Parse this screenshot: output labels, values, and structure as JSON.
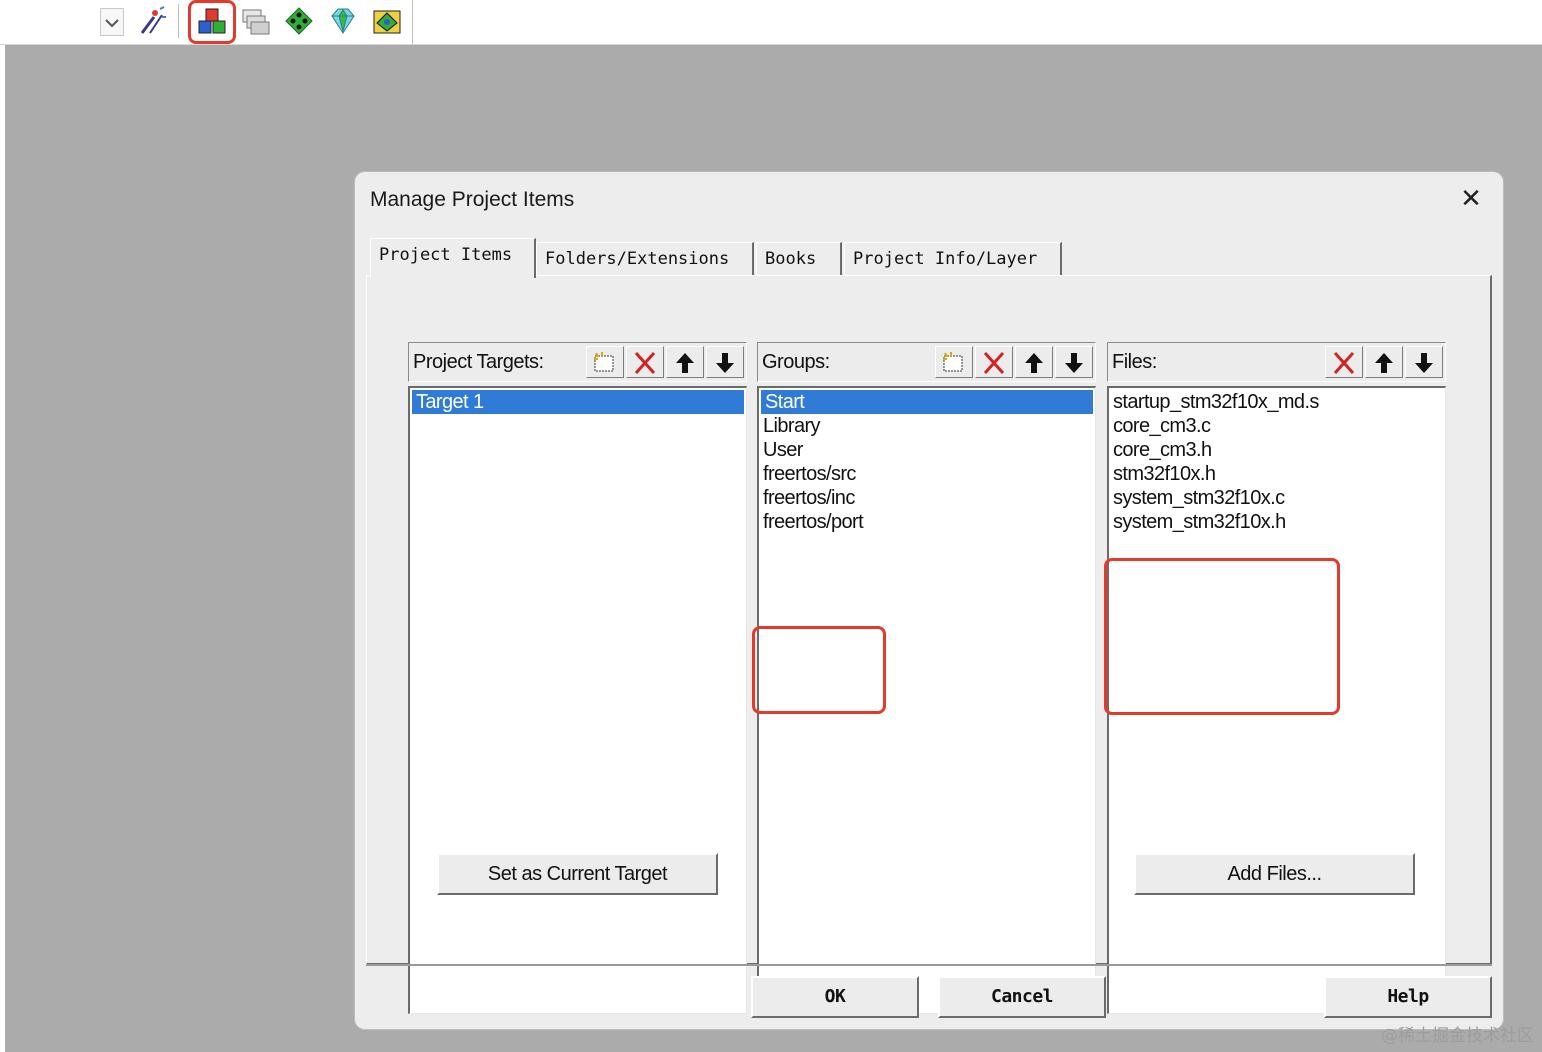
{
  "toolbar": {
    "icons": [
      "dropdown-arrow-icon",
      "magic-wand-icon",
      "manage-project-items-icon",
      "select-packs-icon",
      "manage-run-time-environment-icon",
      "pack-installer-icon",
      "components-icon"
    ]
  },
  "dialog": {
    "title": "Manage Project Items",
    "close_symbol": "✕",
    "tabs": [
      {
        "label": "Project Items"
      },
      {
        "label": "Folders/Extensions"
      },
      {
        "label": "Books"
      },
      {
        "label": "Project Info/Layer"
      }
    ],
    "targets": {
      "label": "Project Targets:",
      "items": [
        "Target 1"
      ],
      "selected_index": 0
    },
    "groups": {
      "label": "Groups:",
      "items": [
        "Start",
        "Library",
        "User",
        "freertos/src",
        "freertos/inc",
        "freertos/port"
      ],
      "selected_index": 0
    },
    "files": {
      "label": "Files:",
      "items": [
        "startup_stm32f10x_md.s",
        "core_cm3.c",
        "core_cm3.h",
        "stm32f10x.h",
        "system_stm32f10x.c",
        "system_stm32f10x.h"
      ]
    },
    "buttons": {
      "set_current_target": "Set as Current Target",
      "add_files": "Add Files...",
      "ok": "OK",
      "cancel": "Cancel",
      "help": "Help"
    }
  },
  "watermark": "@稀土掘金技术社区",
  "colors": {
    "highlight": "#e23b2e",
    "selection": "#2f7bd5",
    "desktop": "#ababab",
    "dialog_bg": "#ededed"
  }
}
